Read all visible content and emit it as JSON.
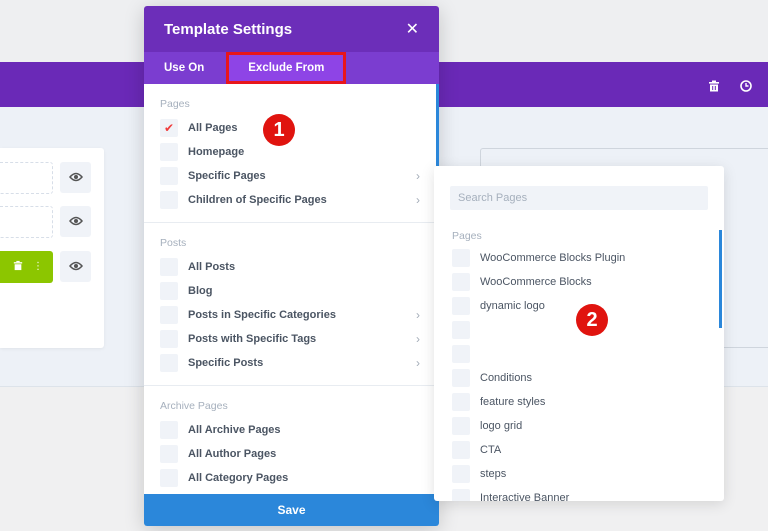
{
  "modal": {
    "title": "Template Settings",
    "close_icon": "close-icon",
    "tabs": [
      {
        "label": "Use On",
        "active": false
      },
      {
        "label": "Exclude From",
        "active": true
      }
    ],
    "sections": [
      {
        "title": "Pages",
        "options": [
          {
            "label": "All Pages",
            "checked": true,
            "has_submenu": false
          },
          {
            "label": "Homepage",
            "checked": false,
            "has_submenu": false
          },
          {
            "label": "Specific Pages",
            "checked": false,
            "has_submenu": true
          },
          {
            "label": "Children of Specific Pages",
            "checked": false,
            "has_submenu": true
          }
        ]
      },
      {
        "title": "Posts",
        "options": [
          {
            "label": "All Posts",
            "checked": false,
            "has_submenu": false
          },
          {
            "label": "Blog",
            "checked": false,
            "has_submenu": false
          },
          {
            "label": "Posts in Specific Categories",
            "checked": false,
            "has_submenu": true
          },
          {
            "label": "Posts with Specific Tags",
            "checked": false,
            "has_submenu": true
          },
          {
            "label": "Specific Posts",
            "checked": false,
            "has_submenu": true
          }
        ]
      },
      {
        "title": "Archive Pages",
        "options": [
          {
            "label": "All Archive Pages",
            "checked": false,
            "has_submenu": false
          },
          {
            "label": "All Author Pages",
            "checked": false,
            "has_submenu": false
          },
          {
            "label": "All Category Pages",
            "checked": false,
            "has_submenu": false
          }
        ]
      }
    ],
    "save_label": "Save",
    "check_glyph": "✔",
    "chevron_glyph": "›"
  },
  "flyout": {
    "search_placeholder": "Search Pages",
    "section_title": "Pages",
    "pages": [
      "WooCommerce Blocks Plugin",
      "WooCommerce Blocks",
      "dynamic logo",
      "",
      "",
      "Conditions",
      "feature styles",
      "logo grid",
      "CTA",
      "steps",
      "Interactive Banner"
    ]
  },
  "annotations": [
    {
      "label": "1"
    },
    {
      "label": "2"
    }
  ],
  "colors": {
    "header_purple": "#6c2eb9",
    "tab_purple": "#7b3dd0",
    "active_tab": "#8e44e6",
    "highlight_red": "#e8161c",
    "save_blue": "#2b87da",
    "badge_red": "#e0140f",
    "row_green": "#8cc600"
  }
}
